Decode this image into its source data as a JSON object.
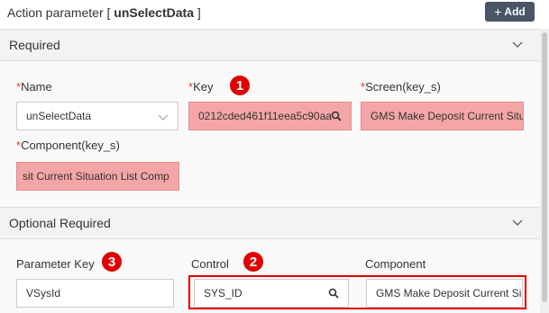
{
  "header": {
    "title_prefix": "Action parameter [ ",
    "title_name": "unSelectData",
    "title_suffix": " ]",
    "add_label": "Add"
  },
  "required": {
    "title": "Required",
    "name_label": "Name",
    "name_value": "unSelectData",
    "key_label": "Key",
    "key_value": "0212cded461f11eea5c90aa",
    "screen_label": "Screen(key_s)",
    "screen_value": "GMS Make Deposit Current Situ",
    "component_label": "Component(key_s)",
    "component_value": "sit Current Situation List Comp"
  },
  "optional": {
    "title": "Optional Required",
    "param_key_label": "Parameter Key",
    "param_key_value": "VSysId",
    "control_label": "Control",
    "control_value": "SYS_ID",
    "component_label": "Component",
    "component_value": "GMS Make Deposit Current Si"
  },
  "badges": {
    "one": "1",
    "two": "2",
    "three": "3"
  },
  "required_marker": "*",
  "colors": {
    "highlight": "#f4a6a6",
    "callout": "#e00000",
    "button": "#4a5566"
  },
  "icons": {
    "add": "plus-icon",
    "search": "search-icon",
    "collapse": "chevron-down-icon"
  }
}
